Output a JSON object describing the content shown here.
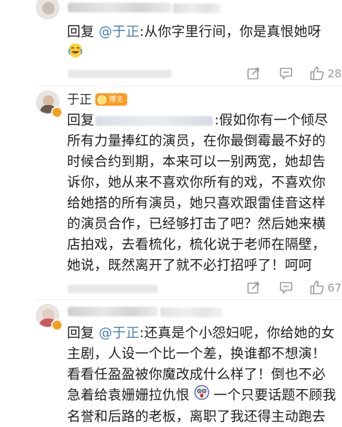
{
  "comment1": {
    "reply_prefix": "回复",
    "mention": "@于正",
    "text": ":从你字里行间，你是真恨她呀",
    "emoji": "crying-laughing-emoji",
    "like_count": "28"
  },
  "comment2": {
    "author": "于正",
    "badge": "博主",
    "reply_prefix": "回复",
    "lines": [
      ":假如你有一个倾尽",
      "所有力量捧红的演员，在你最倒霉最不好的",
      "时候合约到期，本来可以一别两宽，她却告",
      "诉你，她从来不喜欢你所有的戏，不喜欢你",
      "给她搭的所有演员，她只喜欢跟雷佳音这样",
      "的演员合作，已经够打击了吧？然后她来横",
      "店拍戏，去看梳化，梳化说于老师在隔壁，",
      "她说，既然离开了就不必打招呼了！呵呵"
    ],
    "like_count": "67"
  },
  "comment3": {
    "reply_prefix": "回复",
    "mention": "@于正",
    "line1": ":还真是个小怨妇呢，你给她的女",
    "lines": [
      "主剧，人设一个比一个差，换谁都不想演！",
      "看看任盈盈被你魔改成什么样了！倒也不必"
    ],
    "line4_a": "急着给袁姗姗拉仇恨",
    "line4_b": "一个只要话题不顾我",
    "line5": "名誉和后路的老板，离职了我还得主动跑去",
    "emoji": "scared-face-emoji"
  },
  "icons": {
    "share": "share-icon",
    "comment": "comment-icon",
    "like": "thumbs-up-icon"
  },
  "colors": {
    "mention": "#4a7fb5",
    "badge": "#ff9a1f",
    "meta": "#9a9a9a"
  }
}
